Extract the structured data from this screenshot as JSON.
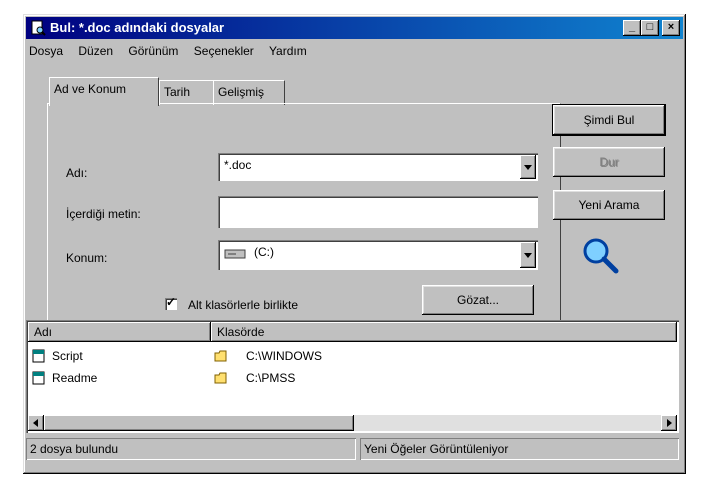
{
  "window": {
    "title": "Bul: *.doc adındaki dosyalar",
    "minimize": "_",
    "maximize": "□",
    "close": "×"
  },
  "menu": [
    {
      "label": "Dosya"
    },
    {
      "label": "Düzen"
    },
    {
      "label": "Görünüm"
    },
    {
      "label": "Seçenekler"
    },
    {
      "label": "Yardım"
    }
  ],
  "tabs": [
    {
      "label": "Ad ve Konum",
      "active": true
    },
    {
      "label": "Tarih"
    },
    {
      "label": "Gelişmiş"
    }
  ],
  "form": {
    "name_label": "Adı:",
    "name_value": "*.doc",
    "content_label": "İçerdiği metin:",
    "content_value": "",
    "location_label": "Konum:",
    "location_value": "(C:)",
    "subfolders_label": "Alt klasörlerle birlikte",
    "subfolders_checked": true,
    "browse_button": "Gözat..."
  },
  "actions": {
    "find_now": "Şimdi Bul",
    "stop": "Dur",
    "new_search": "Yeni Arama"
  },
  "results": {
    "columns": [
      "Adı",
      "Klasörde"
    ],
    "rows": [
      {
        "name": "Script",
        "folder": "C:\\WINDOWS"
      },
      {
        "name": "Readme",
        "folder": "C:\\PMSS"
      }
    ]
  },
  "status": {
    "found": "2 dosya bulundu",
    "monitoring": "Yeni Öğeler Görüntüleniyor"
  },
  "colors": {
    "title_start": "#000080",
    "title_end": "#1084d0",
    "face": "#c0c0c0"
  }
}
